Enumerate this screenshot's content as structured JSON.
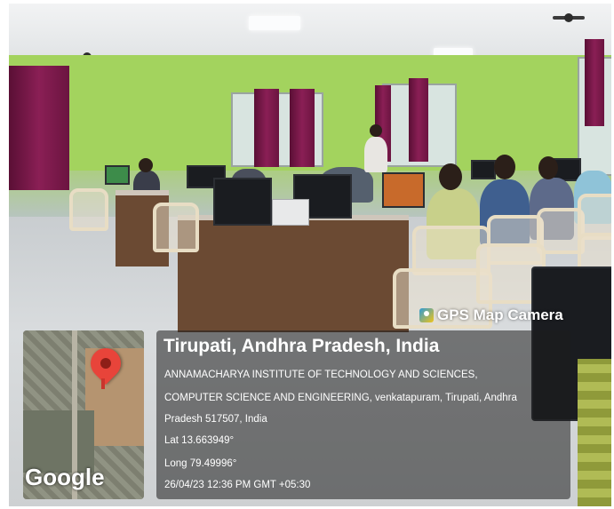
{
  "overlay": {
    "brand": "GPS Map Camera",
    "map_label": "Google",
    "location_title": "Tirupati, Andhra Pradesh, India",
    "address_line1": "ANNAMACHARYA INSTITUTE OF TECHNOLOGY AND SCIENCES,",
    "address_line2": "COMPUTER SCIENCE AND ENGINEERING, venkatapuram, Tirupati, Andhra",
    "address_line3": "Pradesh 517507, India",
    "lat": "Lat 13.663949°",
    "long": "Long 79.49996°",
    "timestamp": "26/04/23 12:36 PM GMT +05:30"
  },
  "colors": {
    "wall": "#a3d35e",
    "curtain": "#7a1a4a",
    "pin": "#e8443a"
  }
}
